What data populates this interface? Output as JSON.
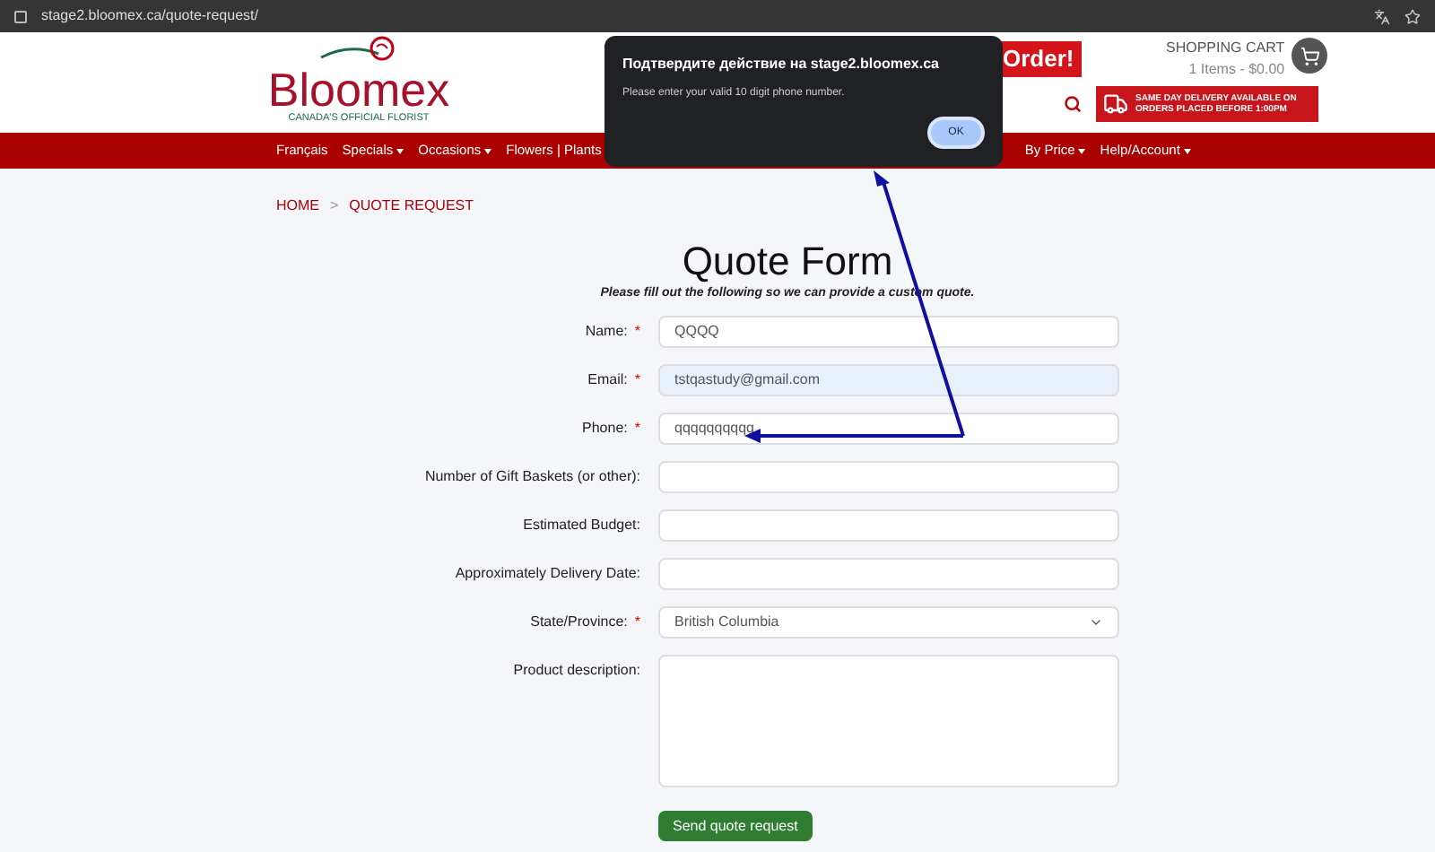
{
  "browser": {
    "url": "stage2.bloomex.ca/quote-request/"
  },
  "header": {
    "logo": "Bloomex",
    "tagline": "CANADA'S OFFICIAL FLORIST",
    "promo": "Order!",
    "cart_title": "SHOPPING CART",
    "cart_summary": "1 Items - $0.00",
    "delivery_banner": [
      "SAME DAY DELIVERY AVAILABLE ON",
      "ORDERS PLACED BEFORE 1:00PM"
    ]
  },
  "nav": [
    {
      "label": "Français",
      "dropdown": false
    },
    {
      "label": "Specials",
      "dropdown": true
    },
    {
      "label": "Occasions",
      "dropdown": true
    },
    {
      "label": "Flowers | Plants",
      "dropdown": false
    },
    {
      "label": "By Price",
      "dropdown": true
    },
    {
      "label": "Help/Account",
      "dropdown": true
    }
  ],
  "breadcrumb": [
    "HOME",
    ">",
    "QUOTE REQUEST"
  ],
  "form": {
    "title": "Quote Form",
    "subtitle": "Please fill out the following so we can provide a custom quote.",
    "fields": [
      {
        "kind": "input",
        "label": "Name:",
        "required": true,
        "value": "QQQQ",
        "autofilled": false
      },
      {
        "kind": "input",
        "label": "Email:",
        "required": true,
        "value": "tstqastudy@gmail.com",
        "autofilled": true
      },
      {
        "kind": "input",
        "label": "Phone:",
        "required": true,
        "value": "qqqqqqqqqq",
        "autofilled": false
      },
      {
        "kind": "input",
        "label": "Number of Gift Baskets (or other):",
        "required": false,
        "autofilled": false
      },
      {
        "kind": "input",
        "label": "Estimated Budget:",
        "required": false,
        "autofilled": false
      },
      {
        "kind": "input",
        "label": "Approximately Delivery Date:",
        "required": false,
        "autofilled": false
      },
      {
        "kind": "select",
        "label": "State/Province:",
        "required": true,
        "value": "British Columbia",
        "autofilled": false
      },
      {
        "kind": "textarea",
        "label": "Product description:",
        "required": false,
        "autofilled": false
      }
    ],
    "required_mark": "*",
    "submit": "Send quote request"
  },
  "dialog": {
    "title": "Подтвердите действие на stage2.bloomex.ca",
    "message": "Please enter your valid 10 digit phone number.",
    "button": "OK"
  }
}
